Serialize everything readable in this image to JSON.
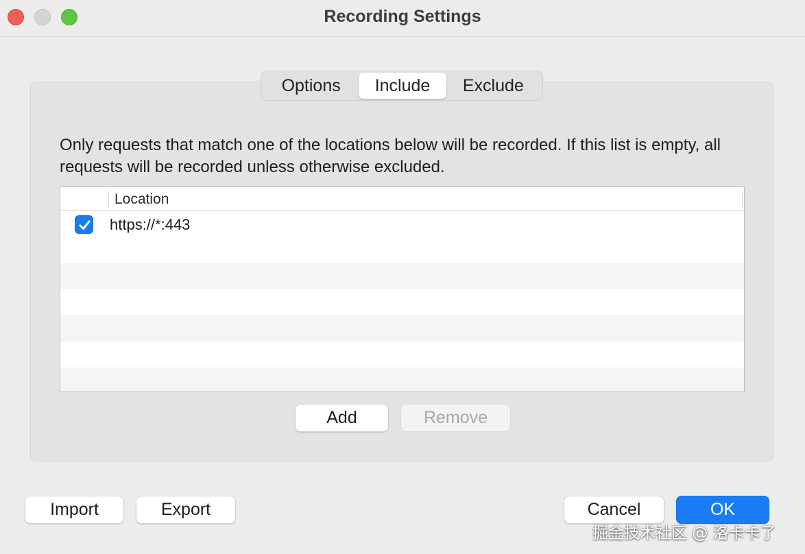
{
  "window": {
    "title": "Recording Settings"
  },
  "tabs": [
    {
      "label": "Options",
      "active": false
    },
    {
      "label": "Include",
      "active": true
    },
    {
      "label": "Exclude",
      "active": false
    }
  ],
  "include": {
    "description": "Only requests that match one of the locations below will be recorded. If this list is empty, all requests will be recorded unless otherwise excluded.",
    "table": {
      "columns": [
        "",
        "Location"
      ],
      "rows": [
        {
          "enabled": true,
          "location": "https://*:443"
        }
      ]
    },
    "add_label": "Add",
    "remove_label": "Remove"
  },
  "footer": {
    "import_label": "Import",
    "export_label": "Export",
    "cancel_label": "Cancel",
    "ok_label": "OK"
  },
  "watermark": "掘金技术社区 @ 洛卡卡了",
  "colors": {
    "accent": "#1a7cf5",
    "close": "#ee5f57",
    "maximize": "#5fc63f"
  },
  "icons": {
    "checkbox": "checkmark-icon"
  }
}
